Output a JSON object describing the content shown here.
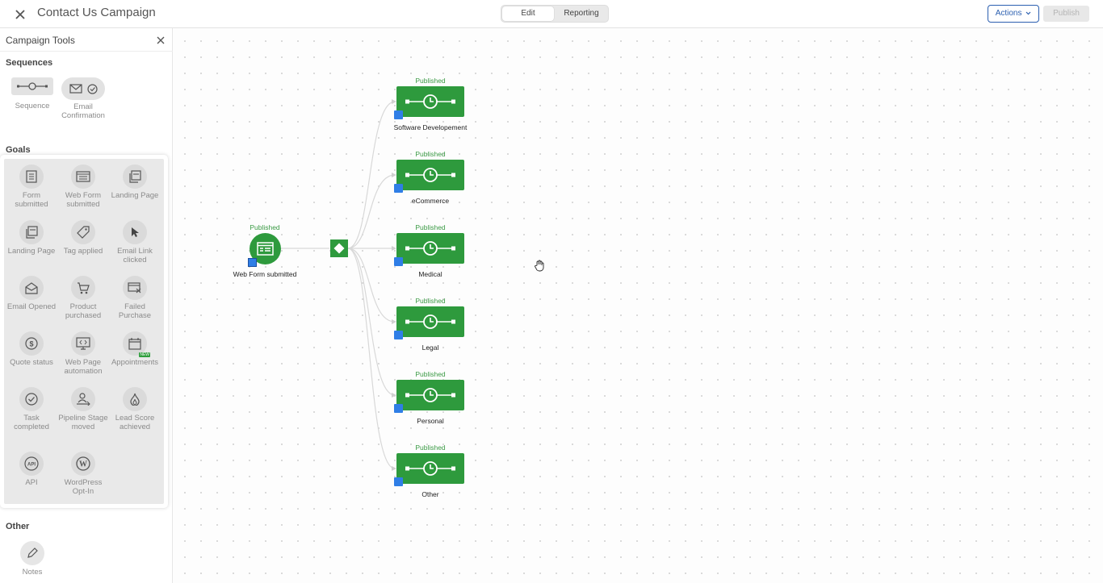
{
  "header": {
    "title": "Contact Us Campaign",
    "tabs": [
      {
        "label": "Edit"
      },
      {
        "label": "Reporting"
      }
    ],
    "actions_label": "Actions",
    "publish_label": "Publish"
  },
  "sidebar": {
    "title": "Campaign Tools",
    "sequences_title": "Sequences",
    "sequences": [
      {
        "label": "Sequence",
        "icon": "sequence-icon"
      },
      {
        "label": "Email Confirmation",
        "icon": "email-confirmation-icon"
      }
    ],
    "goals_title": "Goals",
    "goals": [
      {
        "label": "Form submitted",
        "icon": "form-icon"
      },
      {
        "label": "Web Form submitted",
        "icon": "web-form-icon"
      },
      {
        "label": "Landing Page",
        "icon": "landing-page-icon"
      },
      {
        "label": "Landing Page",
        "icon": "landing-page-icon"
      },
      {
        "label": "Tag applied",
        "icon": "tag-icon"
      },
      {
        "label": "Email Link clicked",
        "icon": "cursor-icon"
      },
      {
        "label": "Email Opened",
        "icon": "email-opened-icon"
      },
      {
        "label": "Product purchased",
        "icon": "cart-icon"
      },
      {
        "label": "Failed Purchase",
        "icon": "failed-purchase-icon"
      },
      {
        "label": "Quote status",
        "icon": "dollar-icon"
      },
      {
        "label": "Web Page automation",
        "icon": "web-page-icon"
      },
      {
        "label": "Appointments",
        "icon": "calendar-icon",
        "badge": "NEW"
      },
      {
        "label": "Task completed",
        "icon": "check-icon"
      },
      {
        "label": "Pipeline Stage moved",
        "icon": "pipeline-icon"
      },
      {
        "label": "Lead Score achieved",
        "icon": "flame-icon"
      },
      {
        "label": "API",
        "icon": "api-icon"
      },
      {
        "label": "WordPress Opt-In",
        "icon": "wordpress-icon"
      }
    ],
    "other_title": "Other",
    "other": [
      {
        "label": "Notes",
        "icon": "pencil-icon"
      }
    ]
  },
  "canvas": {
    "goal_node": {
      "status": "Published",
      "label": "Web Form submitted"
    },
    "sequences": [
      {
        "status": "Published",
        "label": "Software Developement"
      },
      {
        "status": "Published",
        "label": "eCommerce"
      },
      {
        "status": "Published",
        "label": "Medical"
      },
      {
        "status": "Published",
        "label": "Legal"
      },
      {
        "status": "Published",
        "label": "Personal"
      },
      {
        "status": "Published",
        "label": "Other"
      }
    ]
  },
  "colors": {
    "node_green": "#2e9a3d",
    "status_green": "#3a9a44",
    "accent_blue": "#2b5fb0",
    "flag_blue": "#2f7ee6"
  }
}
